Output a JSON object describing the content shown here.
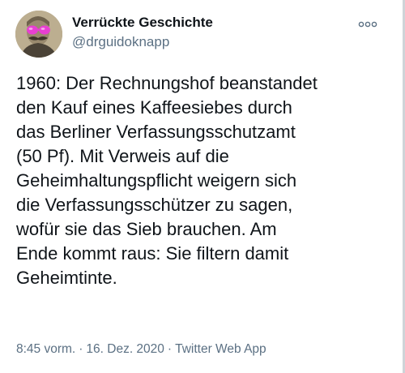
{
  "tweet": {
    "author": {
      "display_name": "Verrückte Geschichte",
      "handle": "@drguidoknapp",
      "avatar_icon": "avatar-portrait-pink-glasses"
    },
    "more_icon": "more-options-icon",
    "text_lines": [
      "1960: Der Rechnungshof beanstandet",
      "den Kauf eines Kaffeesiebes durch",
      "das Berliner Verfassungsschutzamt",
      "(50 Pf). Mit Verweis auf die",
      "Geheimhaltungspflicht weigern sich",
      "die Verfassungsschützer zu sagen,",
      "wofür sie das Sieb brauchen. Am",
      "Ende kommt raus: Sie filtern damit",
      "Geheimtinte."
    ],
    "meta": {
      "time": "8:45 vorm.",
      "separator": "·",
      "date": "16. Dez. 2020",
      "source": "Twitter Web App"
    }
  },
  "colors": {
    "text": "#0f1419",
    "secondary": "#5b7083",
    "avatar_glasses": "#e83fd2"
  }
}
